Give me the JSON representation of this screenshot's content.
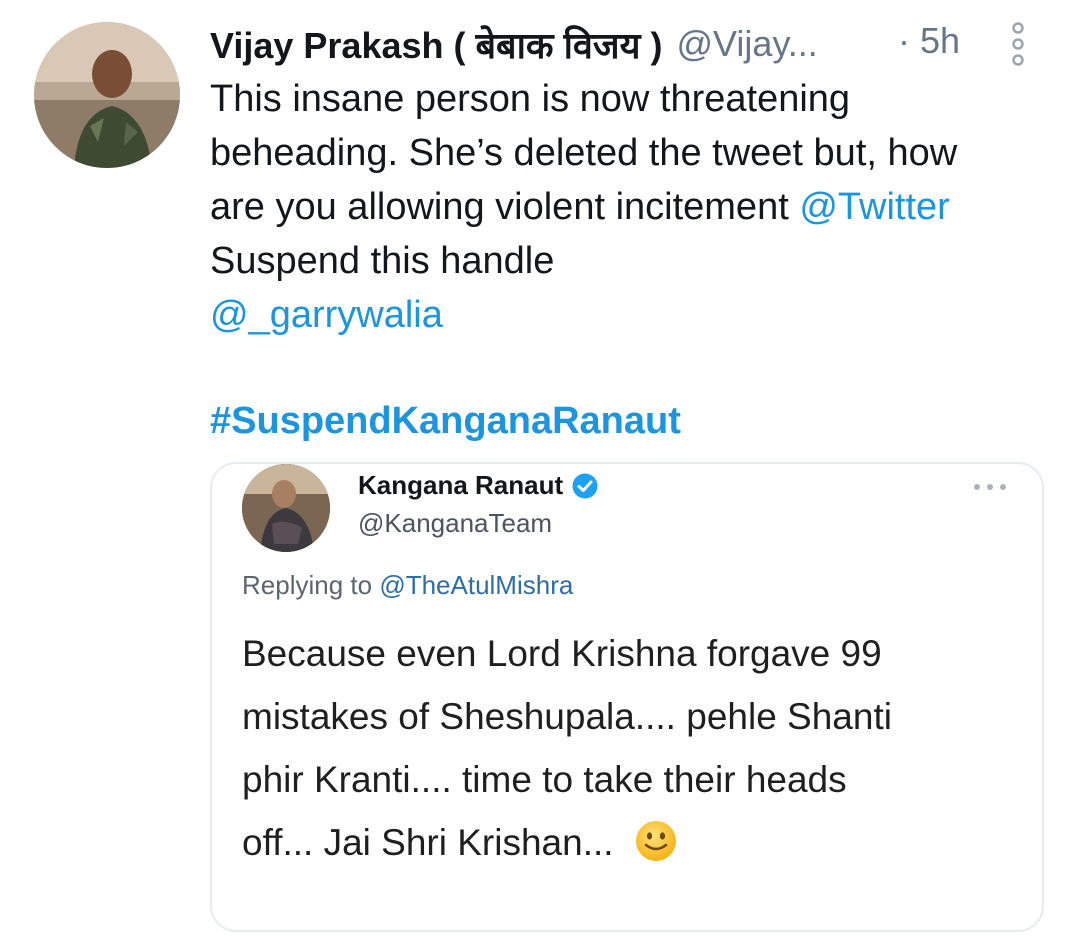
{
  "tweet": {
    "author_name": "Vijay Prakash ( बेबाक विजय )",
    "author_handle": "@Vijay...",
    "separator": "·",
    "time": "5h",
    "more_icon": "more-vertical-icon",
    "text_lines": [
      "This insane person is now threatening",
      "beheading. She’s deleted the tweet but, how",
      "are you allowing violent incitement "
    ],
    "mention_twitter": "@Twitter",
    "line_4": "Suspend this handle",
    "mention_user": "@_garrywalia",
    "hashtag": "#SuspendKanganaRanaut"
  },
  "quoted": {
    "name": "Kangana Ranaut",
    "handle": "@KanganaTeam",
    "verified_icon": "verified-badge-icon",
    "more_icon": "more-horizontal-icon",
    "replying_prefix": "Replying to ",
    "replying_to": "@TheAtulMishra",
    "text_lines": [
      "Because even Lord Krishna forgave 99",
      "mistakes of Sheshupala.... pehle Shanti",
      "phir Kranti.... time to take their heads",
      "off... Jai Shri Krishan... "
    ],
    "emoji_icon": "slightly-smiling-face-icon"
  },
  "colors": {
    "link": "#1b95e0",
    "secondary_text": "#657786",
    "border": "#e6ecf0",
    "verified": "#1da1f2"
  }
}
